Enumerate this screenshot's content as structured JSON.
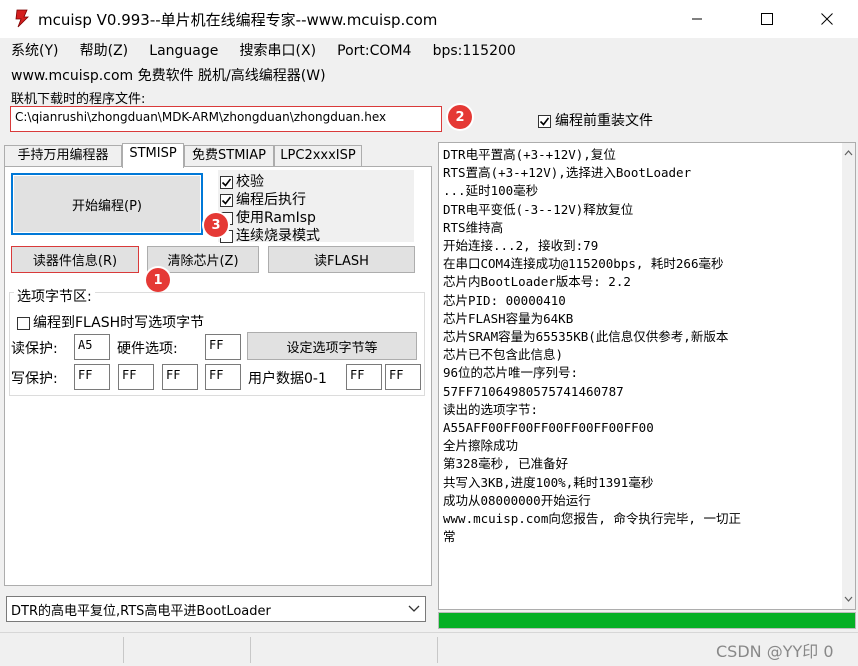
{
  "window": {
    "title": "mcuisp V0.993--单片机在线编程专家--www.mcuisp.com",
    "icon": "mcuisp-app-icon"
  },
  "menu": {
    "items": [
      "系统(Y)",
      "帮助(Z)",
      "Language",
      "搜索串口(X)",
      "Port:COM4",
      "bps:115200"
    ],
    "row2": "www.mcuisp.com 免费软件 脱机/高线编程器(W)"
  },
  "file": {
    "label": "联机下载时的程序文件:",
    "path": "C:\\qianrushi\\zhongduan\\MDK-ARM\\zhongduan\\zhongduan.hex",
    "reload_label": "编程前重装文件",
    "reload_checked": true
  },
  "tabs": [
    "手持万用编程器",
    "STMISP",
    "免费STMIAP",
    "LPC2xxxISP"
  ],
  "active_tab": "STMISP",
  "buttons": {
    "start": "开始编程(P)",
    "read_info": "读器件信息(R)",
    "erase": "清除芯片(Z)",
    "read_flash": "读FLASH",
    "set_option": "设定选项字节等"
  },
  "options": [
    {
      "label": "校验",
      "checked": true
    },
    {
      "label": "编程后执行",
      "checked": true
    },
    {
      "label": "使用RamIsp",
      "checked": false
    },
    {
      "label": "连续烧录模式",
      "checked": false
    }
  ],
  "option_bytes": {
    "title": "选项字节区:",
    "write_flash_label": "编程到FLASH时写选项字节",
    "write_flash_checked": false,
    "read_protect_label": "读保护:",
    "read_protect_value": "A5",
    "hw_option_label": "硬件选项:",
    "hw_option_value": "FF",
    "write_protect_label": "写保护:",
    "write_protect_values": [
      "FF",
      "FF",
      "FF",
      "FF"
    ],
    "user_data_label": "用户数据0-1",
    "user_data_values": [
      "FF",
      "FF"
    ]
  },
  "reset_mode": "DTR的高电平复位,RTS高电平进BootLoader",
  "badges": [
    "1",
    "2",
    "3"
  ],
  "log": [
    "DTR电平置高(+3-+12V),复位",
    "RTS置高(+3-+12V),选择进入BootLoader",
    "...延时100毫秒",
    "DTR电平变低(-3--12V)释放复位",
    "RTS维持高",
    "开始连接...2, 接收到:79",
    "在串口COM4连接成功@115200bps, 耗时266毫秒",
    "芯片内BootLoader版本号: 2.2",
    "芯片PID: 00000410",
    "芯片FLASH容量为64KB",
    "芯片SRAM容量为65535KB(此信息仅供参考,新版本",
    "芯片已不包含此信息)",
    "96位的芯片唯一序列号:",
    "57FF71064980575741460787",
    "读出的选项字节:",
    "A55AFF00FF00FF00FF00FF00FF00",
    "全片擦除成功",
    "第328毫秒, 已准备好",
    "共写入3KB,进度100%,耗时1391毫秒",
    "成功从08000000开始运行",
    "www.mcuisp.com向您报告, 命令执行完毕, 一切正",
    "常"
  ],
  "progress": 1.0,
  "watermark": "CSDN @YY印 0",
  "colors": {
    "progress": "#06b025",
    "badge": "#e53935",
    "highlight_border": "#d93a3a",
    "focus_border": "#0078d7"
  }
}
